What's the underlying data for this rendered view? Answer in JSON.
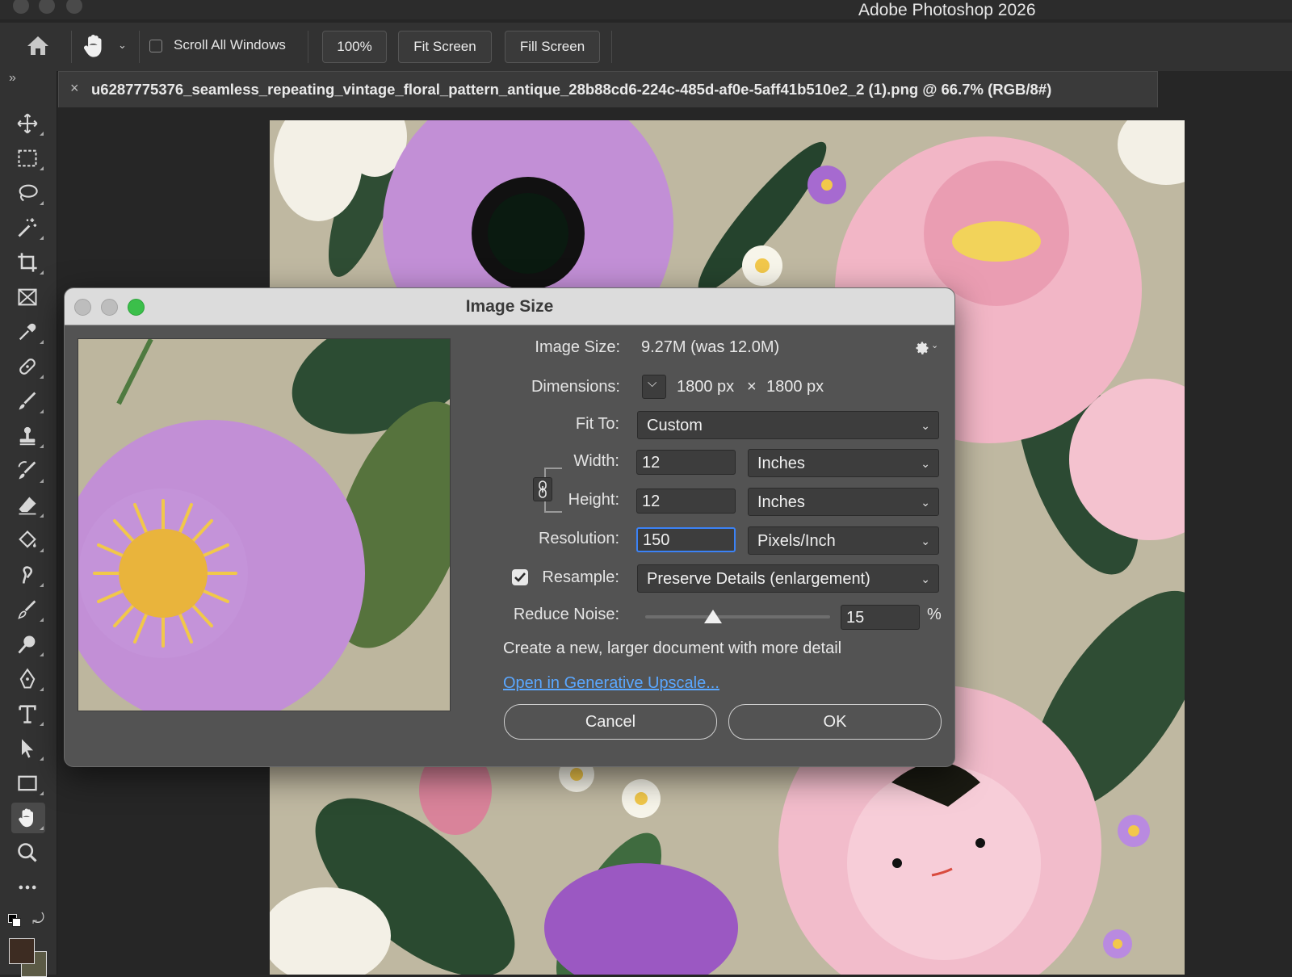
{
  "app": {
    "title": "Adobe Photoshop 2026"
  },
  "options_bar": {
    "scroll_all_windows_label": "Scroll All Windows",
    "scroll_all_windows_checked": false,
    "zoom_100_label": "100%",
    "fit_screen_label": "Fit Screen",
    "fill_screen_label": "Fill Screen"
  },
  "document": {
    "tab_title": "u6287775376_seamless_repeating_vintage_floral_pattern_antique_28b88cd6-224c-485d-af0e-5aff41b510e2_2 (1).png @ 66.7% (RGB/8#)",
    "close_glyph": "×"
  },
  "toolbar": {
    "expand_glyph": "»",
    "active_tool": "hand-tool"
  },
  "dialog": {
    "title": "Image Size",
    "image_size": {
      "label": "Image Size:",
      "value": "9.27M (was 12.0M)"
    },
    "dimensions": {
      "label": "Dimensions:",
      "width": "1800 px",
      "times": "×",
      "height": "1800 px"
    },
    "fit_to": {
      "label": "Fit To:",
      "value": "Custom"
    },
    "width": {
      "label": "Width:",
      "value": "12",
      "unit": "Inches"
    },
    "height": {
      "label": "Height:",
      "value": "12",
      "unit": "Inches"
    },
    "resolution": {
      "label": "Resolution:",
      "value": "150",
      "unit": "Pixels/Inch"
    },
    "resample": {
      "label": "Resample:",
      "checked": true,
      "value": "Preserve Details (enlargement)"
    },
    "reduce_noise": {
      "label": "Reduce Noise:",
      "value": "15",
      "unit": "%",
      "level": 0.15
    },
    "hint": "Create a new, larger document with more detail",
    "link": "Open in Generative Upscale...",
    "cancel_label": "Cancel",
    "ok_label": "OK"
  },
  "colors": {
    "accent": "#3b82f6",
    "link": "#5aa7ff",
    "foreground_swatch": "#3d2c22",
    "background_swatch": "#5b5a45"
  }
}
